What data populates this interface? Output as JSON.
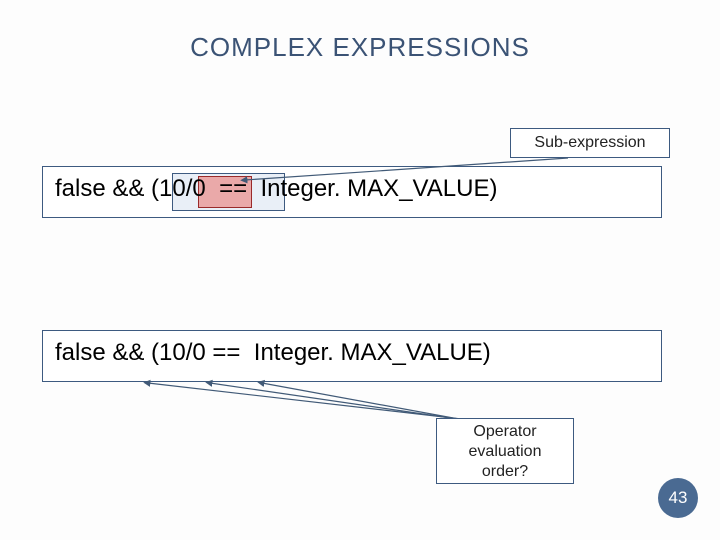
{
  "title": "COMPLEX EXPRESSIONS",
  "callout_sub": "Sub-expression",
  "expr1": "false && (10/0  ==  Integer. MAX_VALUE)",
  "expr2": "false && (10/0 ==  Integer. MAX_VALUE)",
  "callout_op_l1": "Operator",
  "callout_op_l2": "evaluation",
  "callout_op_l3": "order?",
  "page_number": "43"
}
